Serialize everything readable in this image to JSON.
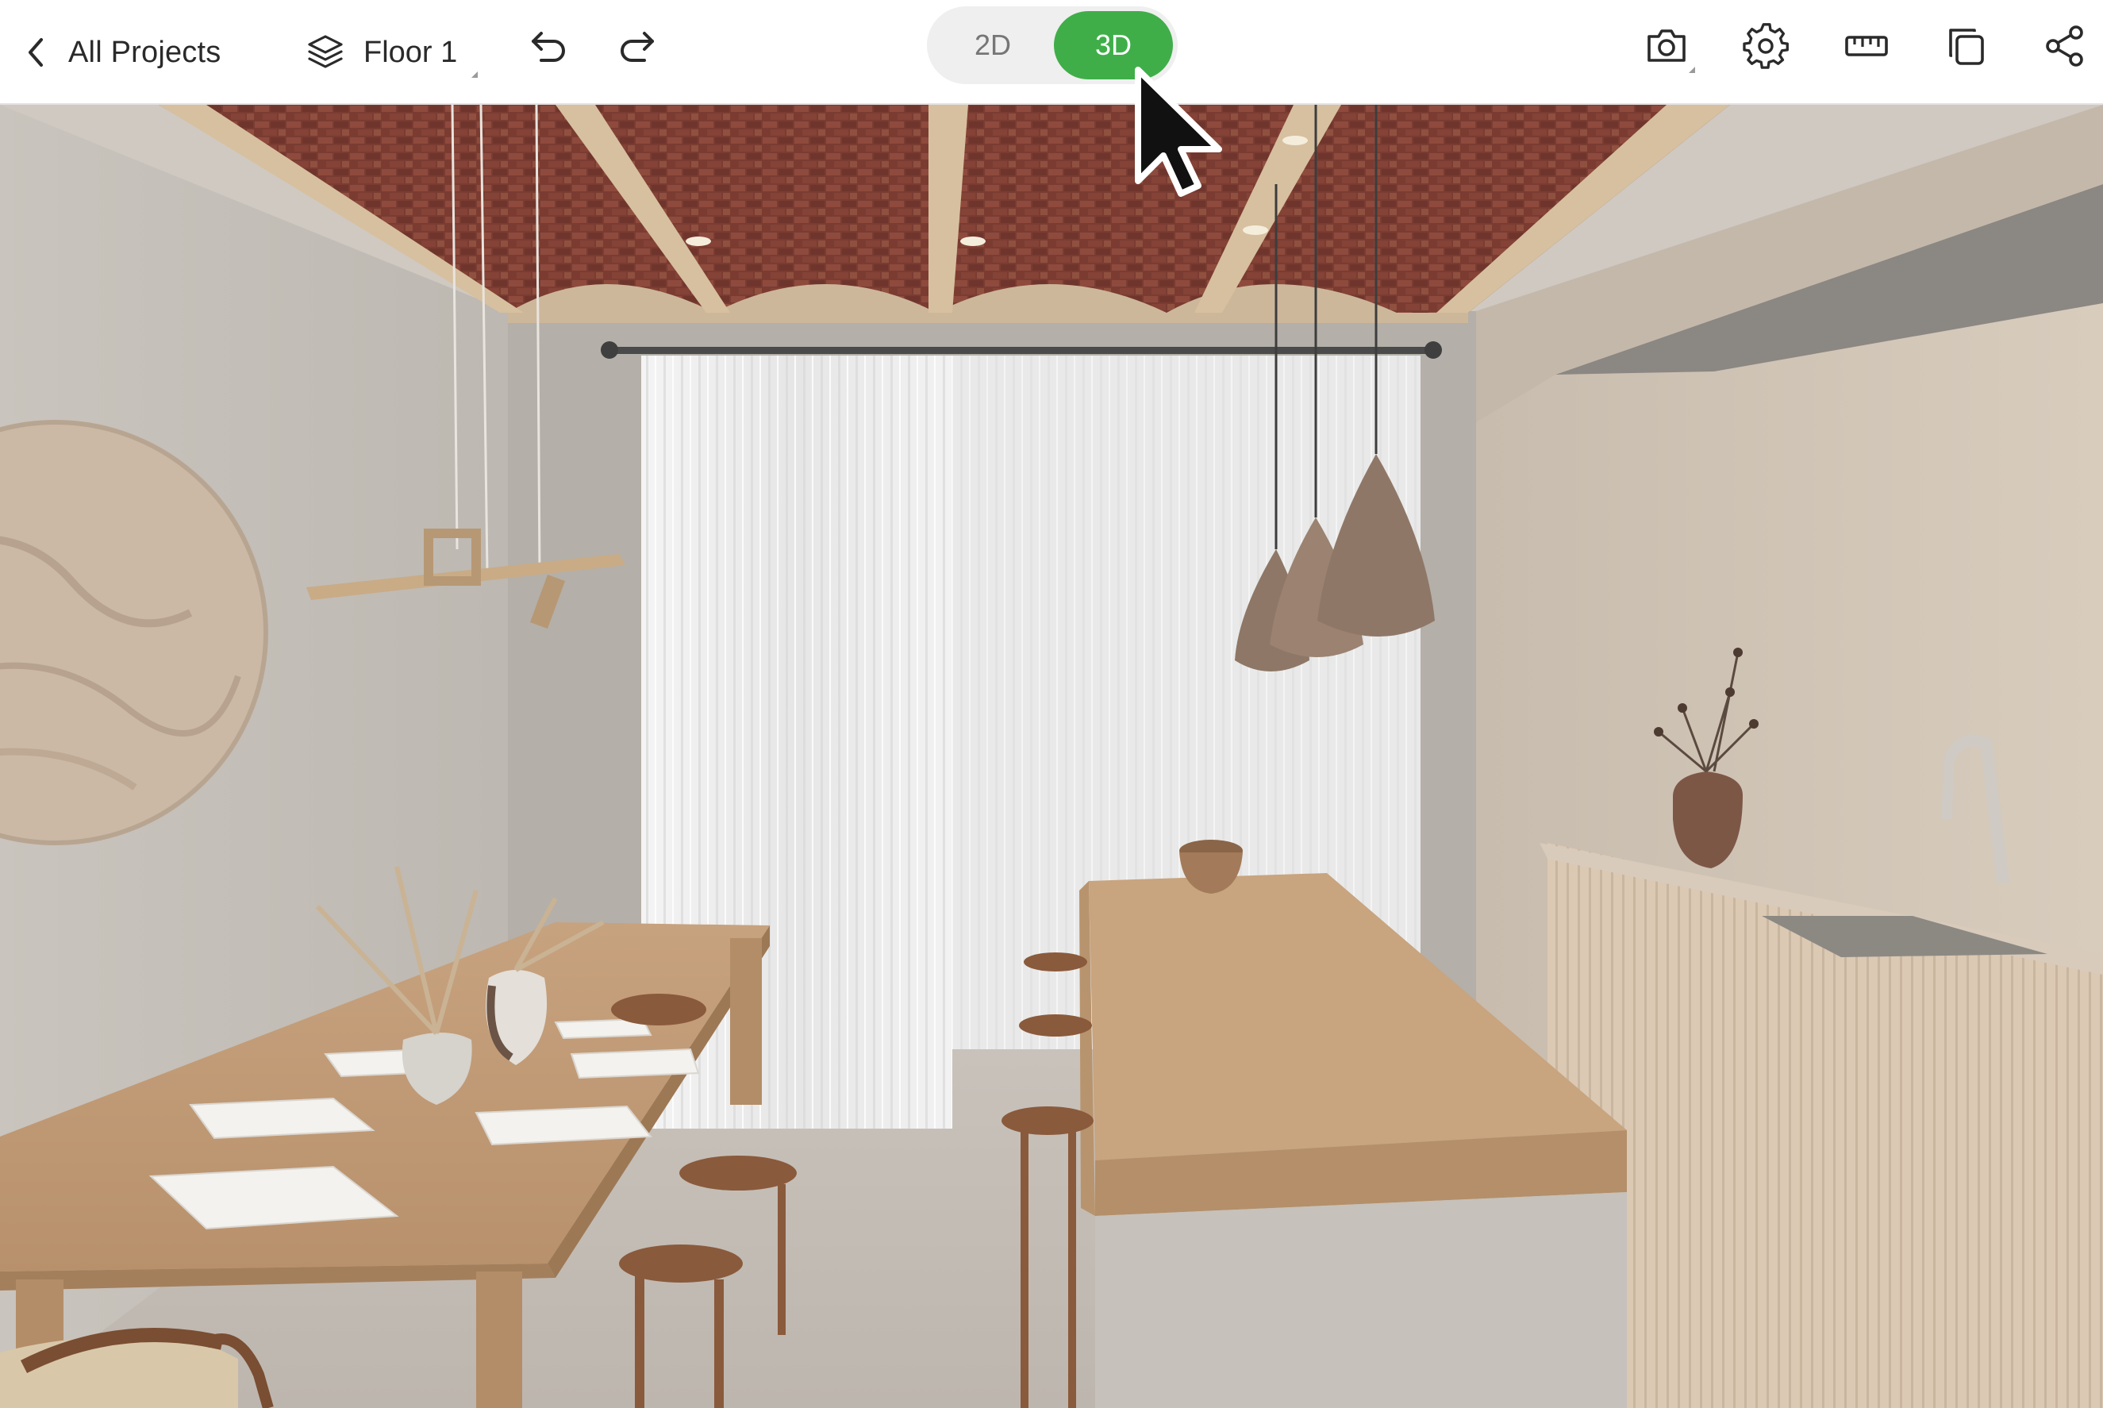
{
  "toolbar": {
    "back_label": "All Projects",
    "floor_label": "Floor 1",
    "view_toggle": {
      "option_2d": "2D",
      "option_3d": "3D",
      "selected": "3D"
    },
    "icons": {
      "back": "chevron-left-icon",
      "floor": "layers-icon",
      "undo": "undo-icon",
      "redo": "redo-icon",
      "snapshot": "camera-icon",
      "settings": "gear-icon",
      "measure": "ruler-icon",
      "duplicate": "copy-icon",
      "share": "share-icon"
    }
  },
  "colors": {
    "accent": "#3fae49",
    "toggle_bg": "#efefef",
    "text": "#2a2a2a"
  },
  "viewport": {
    "mode": "3D",
    "scene": "dining-kitchen-room"
  }
}
